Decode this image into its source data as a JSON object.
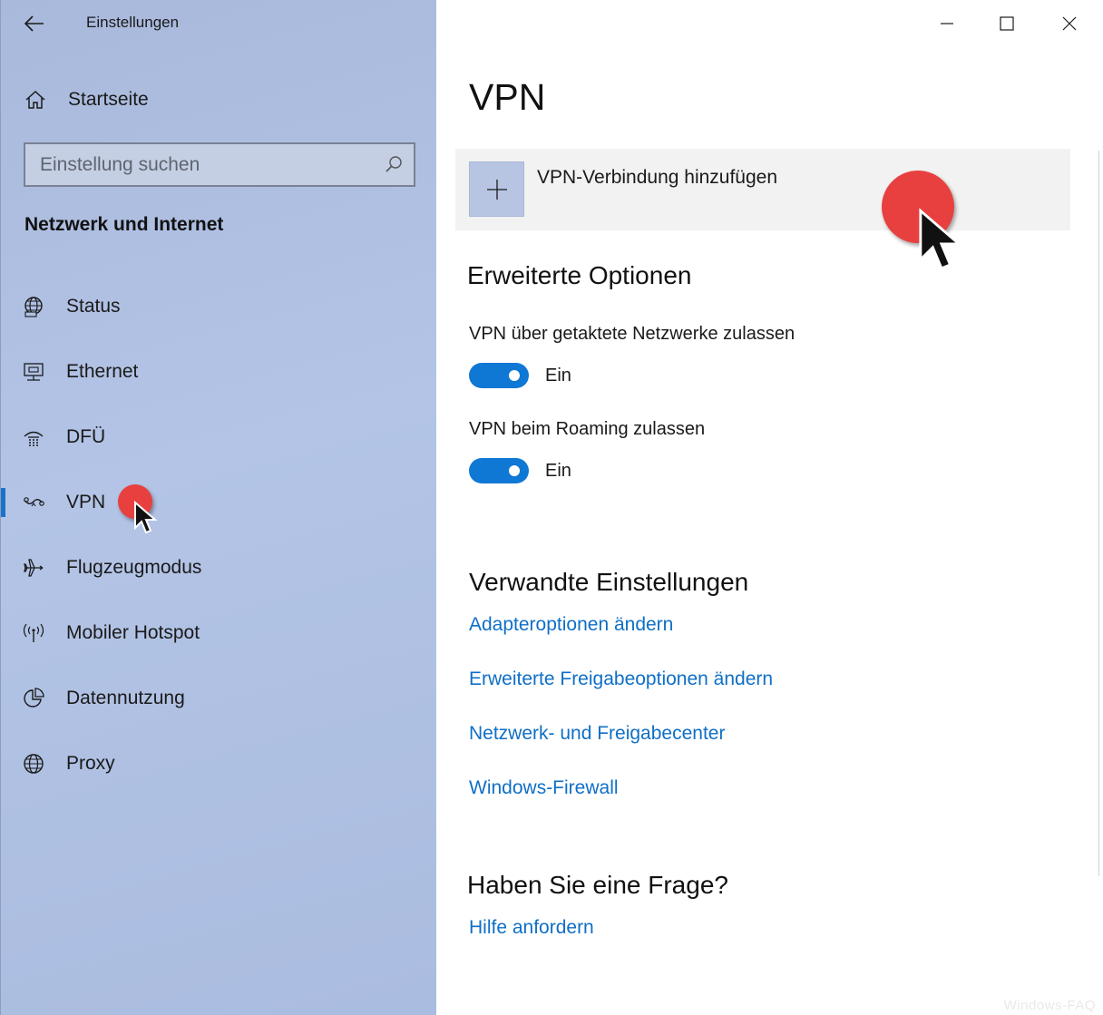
{
  "window": {
    "app_title": "Einstellungen",
    "controls": [
      "minimize-icon",
      "maximize-icon",
      "close-icon"
    ]
  },
  "sidebar": {
    "home_label": "Startseite",
    "search_placeholder": "Einstellung suchen",
    "section_title": "Netzwerk und Internet",
    "selected": "VPN",
    "items": [
      {
        "label": "Status",
        "icon": "globe-status-icon"
      },
      {
        "label": "Ethernet",
        "icon": "ethernet-icon"
      },
      {
        "label": "DFÜ",
        "icon": "dialup-icon"
      },
      {
        "label": "VPN",
        "icon": "vpn-icon"
      },
      {
        "label": "Flugzeugmodus",
        "icon": "airplane-icon"
      },
      {
        "label": "Mobiler Hotspot",
        "icon": "hotspot-icon"
      },
      {
        "label": "Datennutzung",
        "icon": "data-usage-icon"
      },
      {
        "label": "Proxy",
        "icon": "globe-icon"
      }
    ]
  },
  "main": {
    "title": "VPN",
    "add_vpn_label": "VPN-Verbindung hinzufügen",
    "advanced": {
      "title": "Erweiterte Optionen",
      "options": [
        {
          "label": "VPN über getaktete Netzwerke zulassen",
          "state": "Ein",
          "on": true
        },
        {
          "label": "VPN beim Roaming zulassen",
          "state": "Ein",
          "on": true
        }
      ]
    },
    "related": {
      "title": "Verwandte Einstellungen",
      "links": [
        "Adapteroptionen ändern",
        "Erweiterte Freigabeoptionen ändern",
        "Netzwerk- und Freigabecenter",
        "Windows-Firewall"
      ]
    },
    "question": {
      "title": "Haben Sie eine Frage?",
      "link": "Hilfe anfordern"
    }
  },
  "colors": {
    "accent": "#0f78d4",
    "link": "#0f6fc6",
    "sidebar_bg": "#b0c1e3",
    "click_marker": "#e8403f"
  },
  "watermark": "Windows-FAQ"
}
